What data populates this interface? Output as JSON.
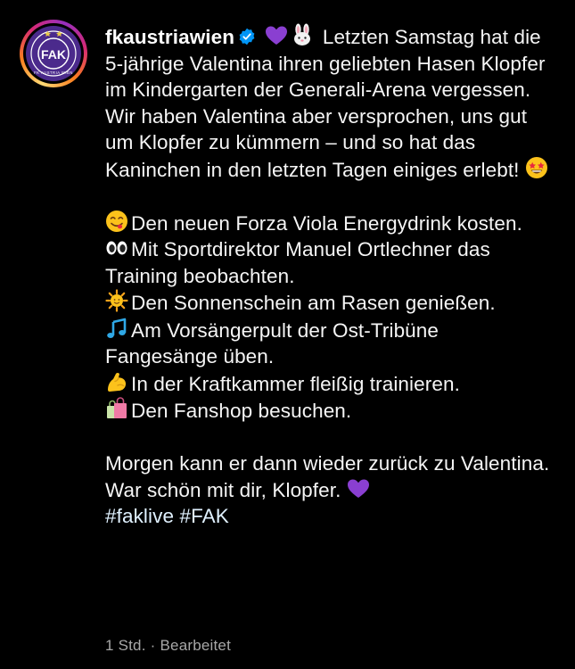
{
  "post": {
    "username": "fkaustriawien",
    "intro_text": "Letzten Samstag hat die 5-jährige Valentina ihren geliebten Hasen Klopfer im Kindergarten der Generali-Arena vergessen. Wir haben Valentina aber versprochen, uns gut um Klopfer zu kümmern – und so hat das Kaninchen in den letzten Tagen einiges erlebt!",
    "activities": [
      {
        "icon": "yum-face-icon",
        "text": "Den neuen Forza Viola Energydrink kosten."
      },
      {
        "icon": "eyes-icon",
        "text": "Mit Sportdirektor Manuel Ortlechner das Training beobachten."
      },
      {
        "icon": "sun-icon",
        "text": "Den Sonnenschein am Rasen genießen."
      },
      {
        "icon": "music-notes-icon",
        "text": "Am Vorsängerpult der Ost-Tribüne Fangesänge üben."
      },
      {
        "icon": "flexed-biceps-icon",
        "text": "In der Kraftkammer fleißig trainieren."
      },
      {
        "icon": "shopping-bags-icon",
        "text": "Den Fanshop besuchen."
      }
    ],
    "outro_text": "Morgen kann er dann wieder zurück zu Valentina. War schön mit dir, Klopfer.",
    "hashtags": [
      "#faklive",
      "#FAK"
    ],
    "time": "1 Std.",
    "separator": "·",
    "edited_label": "Bearbeitet"
  },
  "avatar": {
    "monogram": "FAK",
    "ring_text": "FK AUSTRIA WIEN",
    "icon": "club-crest-icon"
  },
  "colors": {
    "background": "#000000",
    "text": "#f5f5f5",
    "meta": "#a8a8a8",
    "verified": "#0095f6",
    "purple_heart": "#8a3fd1",
    "crest": "#4b2a8c"
  }
}
